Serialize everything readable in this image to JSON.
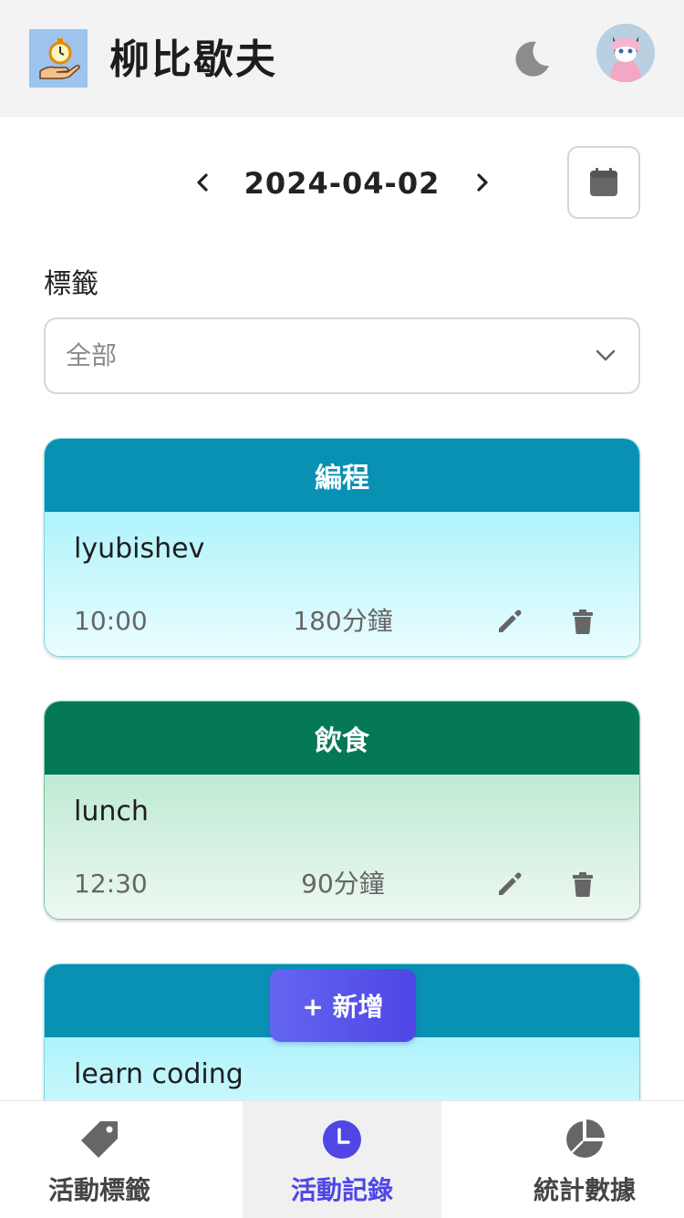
{
  "header": {
    "app_title": "柳比歇夫",
    "logo_icon": "stopwatch-hand-icon",
    "theme_icon": "moon-icon",
    "avatar_icon": "cat-avatar-icon"
  },
  "date_nav": {
    "date": "2024-04-02",
    "prev_icon": "chevron-left-icon",
    "next_icon": "chevron-right-icon",
    "calendar_icon": "calendar-icon"
  },
  "filter": {
    "label": "標籤",
    "selected": "全部"
  },
  "records": [
    {
      "tag": "編程",
      "name": "lyubishev",
      "time": "10:00",
      "duration": "180分鐘",
      "theme": "cyan"
    },
    {
      "tag": "飲食",
      "name": "lunch",
      "time": "12:30",
      "duration": "90分鐘",
      "theme": "green"
    },
    {
      "tag": "",
      "name": "learn coding",
      "time": "",
      "duration": "",
      "theme": "cyan"
    }
  ],
  "add_button": {
    "label": "+ 新增"
  },
  "bottom_nav": [
    {
      "label": "活動標籤",
      "icon": "tag-icon",
      "active": false
    },
    {
      "label": "活動記錄",
      "icon": "clock-icon",
      "active": true
    },
    {
      "label": "統計數據",
      "icon": "pie-chart-icon",
      "active": false
    }
  ],
  "colors": {
    "accent": "#4f46e5",
    "cyan_header": "#0891b2",
    "green_header": "#047857"
  }
}
